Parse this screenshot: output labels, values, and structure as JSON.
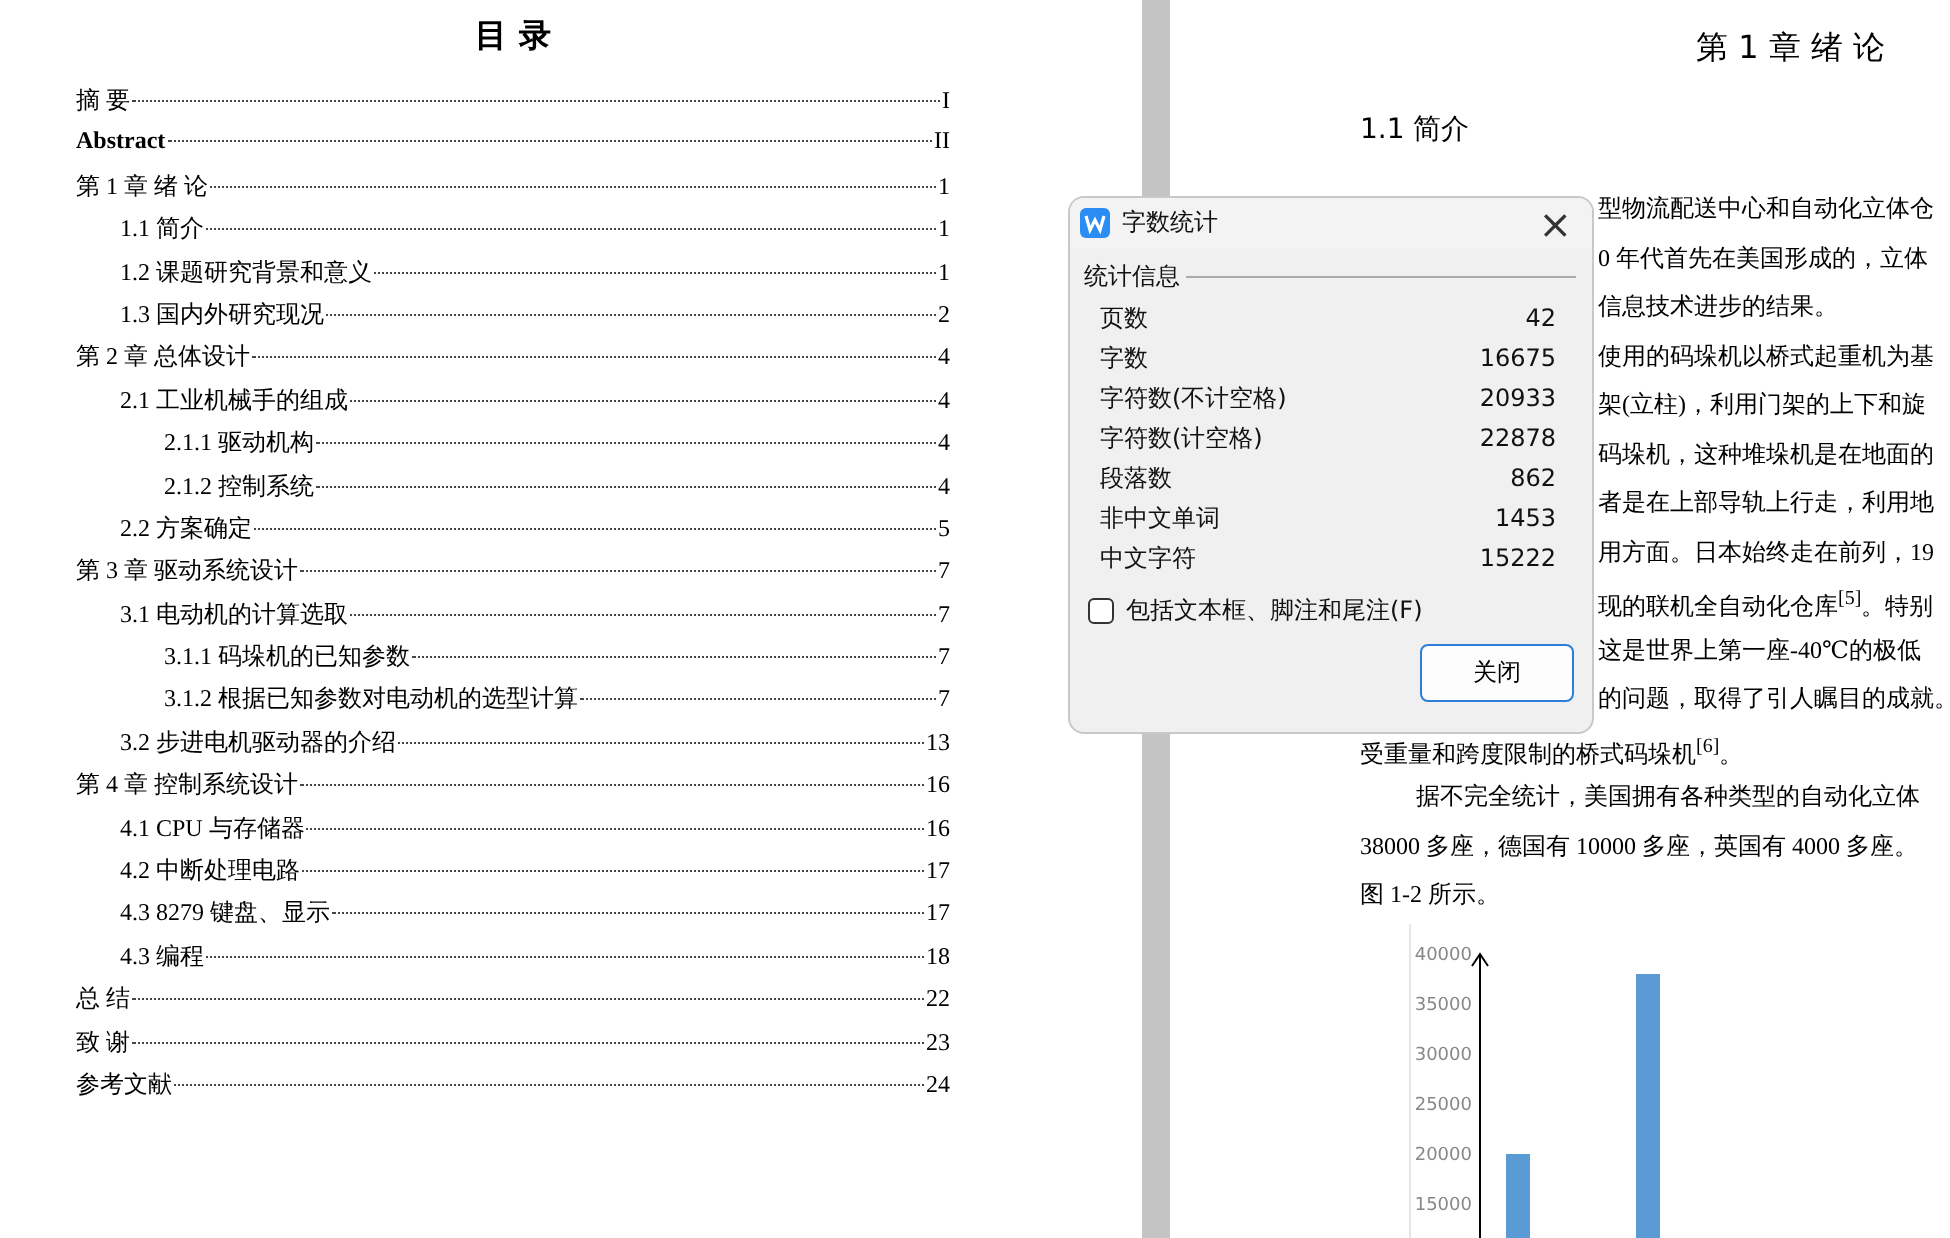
{
  "toc": {
    "title": "目 录",
    "entries": [
      {
        "text": "摘 要",
        "page": "I",
        "bold": false
      },
      {
        "text": "Abstract",
        "page": "II",
        "bold": true
      },
      {
        "text": "第 1 章  绪  论",
        "page": "1",
        "bold": false,
        "children": [
          {
            "text": "1.1 简介",
            "page": "1"
          },
          {
            "text": "1.2  课题研究背景和意义",
            "page": "1"
          },
          {
            "text": "1.3  国内外研究现况",
            "page": "2"
          }
        ]
      },
      {
        "text": "第 2 章  总体设计",
        "page": "4",
        "bold": false,
        "children": [
          {
            "text": "2.1  工业机械手的组成",
            "page": "4",
            "children": [
              {
                "text": "2.1.1  驱动机构",
                "page": "4"
              },
              {
                "text": "2.1.2 控制系统",
                "page": "4"
              }
            ]
          },
          {
            "text": "2.2 方案确定",
            "page": "5"
          }
        ]
      },
      {
        "text": "第 3 章  驱动系统设计",
        "page": "7",
        "bold": false,
        "children": [
          {
            "text": "3.1 电动机的计算选取",
            "page": "7",
            "children": [
              {
                "text": "3.1.1  码垛机的已知参数",
                "page": "7"
              },
              {
                "text": "3.1.2 根据已知参数对电动机的选型计算",
                "page": "7"
              }
            ]
          },
          {
            "text": "3.2 步进电机驱动器的介绍",
            "page": "13"
          }
        ]
      },
      {
        "text": "第 4 章  控制系统设计",
        "page": "16",
        "bold": false,
        "children": [
          {
            "text": "4.1 CPU 与存储器",
            "page": "16"
          },
          {
            "text": "4.2  中断处理电路",
            "page": "17"
          },
          {
            "text": "4.3 8279 键盘、显示",
            "page": "17"
          },
          {
            "text": "4.3 编程",
            "page": "18"
          }
        ]
      },
      {
        "text": "总 结",
        "page": "22",
        "bold": false
      },
      {
        "text": "致    谢",
        "page": "23",
        "bold": false
      },
      {
        "text": "参考文献",
        "page": "24",
        "bold": false
      }
    ]
  },
  "document": {
    "chapter_title": "第 1 章  绪  论",
    "section_title": "1.1 简介",
    "lines": [
      {
        "kind": "covered",
        "text": "型物流配送中心和自动化立体仓"
      },
      {
        "kind": "covered",
        "text": "0 年代首先在美国形成的，立体"
      },
      {
        "kind": "covered",
        "text": "信息技术进步的结果。"
      },
      {
        "kind": "covered",
        "text": "使用的码垛机以桥式起重机为基"
      },
      {
        "kind": "covered",
        "text": "架(立柱)，利用门架的上下和旋"
      },
      {
        "kind": "covered",
        "text": "码垛机，这种堆垛机是在地面的"
      },
      {
        "kind": "covered",
        "text": "者是在上部导轨上行走，利用地"
      },
      {
        "kind": "covered",
        "text": "用方面。日本始终走在前列，19"
      },
      {
        "kind": "covered",
        "text": "现的联机全自动化仓库$^{[5]}$。特别"
      },
      {
        "kind": "covered",
        "text": "这是世界上第一座-40℃的极低"
      },
      {
        "kind": "covered",
        "text": "的问题，取得了引人瞩目的成就。"
      },
      {
        "kind": "plain",
        "text": "受重量和跨度限制的桥式码垛机$^{[6]}$。"
      },
      {
        "kind": "indent",
        "text": "据不完全统计，美国拥有各种类型的自动化立体"
      },
      {
        "kind": "plain",
        "text": "38000 多座，德国有 10000 多座，英国有 4000 多座。"
      },
      {
        "kind": "plain",
        "text": "图 1-2 所示。"
      }
    ],
    "chart_data": {
      "type": "bar",
      "categories": [
        null,
        null
      ],
      "ylim": [
        6200,
        40000
      ],
      "yticks": [
        15000,
        20000,
        25000,
        30000,
        35000,
        40000
      ],
      "series": [
        {
          "color": "#5b9bd5",
          "values": [
            20000,
            38000
          ]
        }
      ]
    }
  },
  "dialog": {
    "title": "字数统计",
    "group_title": "统计信息",
    "stats": [
      {
        "label": "页数",
        "value": "42"
      },
      {
        "label": "字数",
        "value": "16675"
      },
      {
        "label": "字符数(不计空格)",
        "value": "20933"
      },
      {
        "label": "字符数(计空格)",
        "value": "22878"
      },
      {
        "label": "段落数",
        "value": "862"
      },
      {
        "label": "非中文单词",
        "value": "1453"
      },
      {
        "label": "中文字符",
        "value": "15222"
      }
    ],
    "checkbox": {
      "label": "包括文本框、脚注和尾注(F)",
      "checked": false
    },
    "button": "关闭",
    "close_glyph": "×"
  }
}
